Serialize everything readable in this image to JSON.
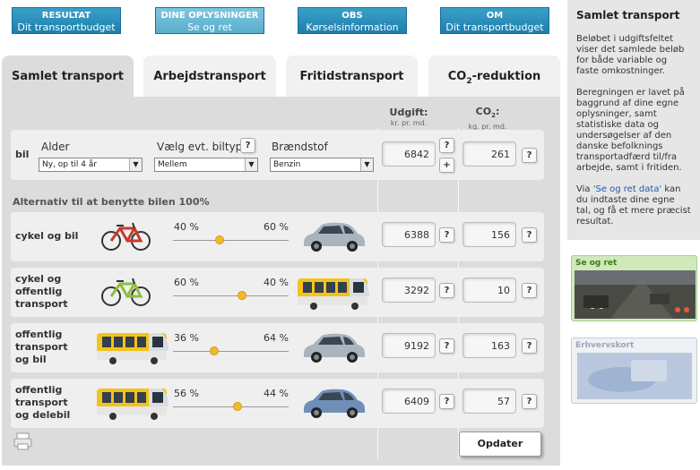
{
  "nav": [
    {
      "line1": "RESULTAT",
      "line2": "Dit transportbudget"
    },
    {
      "line1": "DINE OPLYSNINGER",
      "line2": "Se og ret"
    },
    {
      "line1": "OBS",
      "line2": "Kørselsinformation"
    },
    {
      "line1": "OM",
      "line2": "Dit transportbudget"
    }
  ],
  "tabs": [
    {
      "label": "Samlet transport"
    },
    {
      "label": "Arbejdstransport"
    },
    {
      "label": "Fritidstransport"
    },
    {
      "label_main": "CO",
      "label_sub": "2",
      "label_rest": "-reduktion"
    }
  ],
  "columns": {
    "udgift": {
      "title": "Udgift:",
      "unit": "kr. pr. md."
    },
    "co2": {
      "title_main": "CO",
      "title_sub": "2",
      "title_rest": ":",
      "unit": "kg. pr. md."
    }
  },
  "bil": {
    "label": "bil",
    "alder_label": "Alder",
    "alder_value": "Ny, op til 4 år",
    "biltype_label": "Vælg evt. biltype",
    "biltype_value": "Mellem",
    "braendstof_label": "Brændstof",
    "braendstof_value": "Benzin",
    "udgift": "6842",
    "co2": "261",
    "plus_label": "+",
    "help": "?"
  },
  "section_title": "Alternativ til at benytte bilen 100%",
  "alternatives": [
    {
      "label": [
        "cykel og bil"
      ],
      "pct_left": "40 %",
      "pct_right": "60 %",
      "slider_fraction": 0.4,
      "udgift": "6388",
      "co2": "156",
      "left_vehicle": "bicycle-red",
      "right_vehicle": "car"
    },
    {
      "label": [
        "cykel og",
        "offentlig",
        "transport"
      ],
      "pct_left": "60 %",
      "pct_right": "40 %",
      "slider_fraction": 0.6,
      "udgift": "3292",
      "co2": "10",
      "left_vehicle": "bicycle-green",
      "right_vehicle": "bus"
    },
    {
      "label": [
        "offentlig",
        "transport",
        "og bil"
      ],
      "pct_left": "36 %",
      "pct_right": "64 %",
      "slider_fraction": 0.36,
      "udgift": "9192",
      "co2": "163",
      "left_vehicle": "train",
      "right_vehicle": "car"
    },
    {
      "label": [
        "offentlig",
        "transport",
        "og delebil"
      ],
      "pct_left": "56 %",
      "pct_right": "44 %",
      "slider_fraction": 0.56,
      "udgift": "6409",
      "co2": "57",
      "left_vehicle": "train",
      "right_vehicle": "car-blue"
    }
  ],
  "update_button": "Opdater",
  "sidebar": {
    "title": "Samlet transport",
    "p1": "Beløbet i udgiftsfeltet viser det samlede beløb for både variable og faste omkostninger.",
    "p2": "Beregningen er lavet på baggrund af dine egne oplysninger, samt statistiske data og undersøgelser af den danske befolknings transportadfærd til/fra arbejde, samt i fritiden.",
    "p3_pre": "Via ",
    "p3_link": "'Se og ret data'",
    "p3_post": " kan du indtaste dine egne tal, og få et mere præcist resultat."
  },
  "promos": [
    {
      "title": "Se og ret"
    },
    {
      "title": "Erhvervskort"
    }
  ],
  "colors": {
    "nav_blue": "#1e7fad",
    "panel_grey": "#dcdcdc",
    "slider_knob": "#f2b92e",
    "link": "#2356a8"
  }
}
